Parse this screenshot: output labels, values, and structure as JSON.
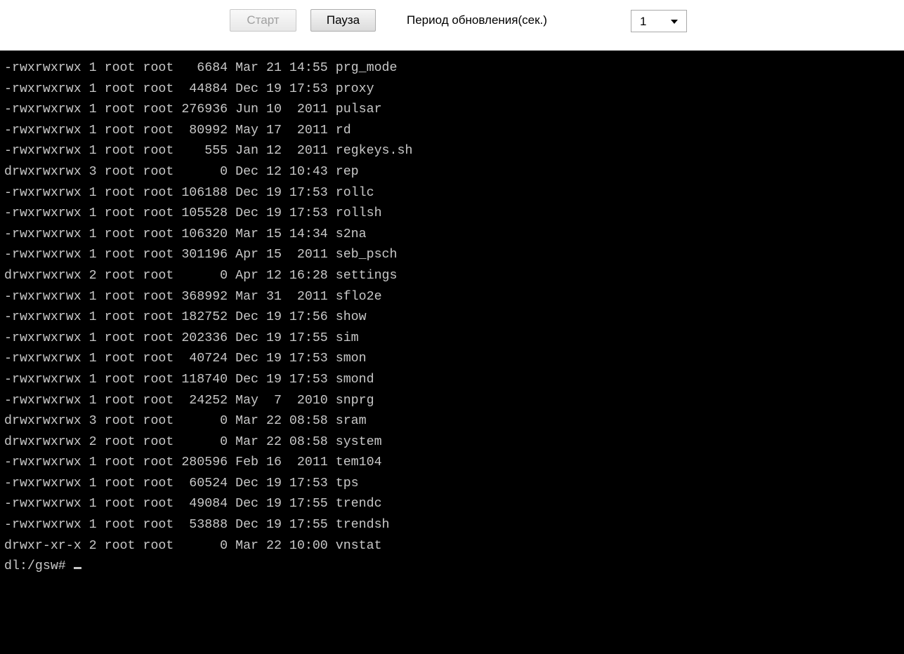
{
  "toolbar": {
    "start_label": "Старт",
    "pause_label": "Пауза",
    "period_label": "Период обновления(сек.)",
    "period_value": "1"
  },
  "terminal": {
    "lines": [
      "-rwxrwxrwx 1 root root   6684 Mar 21 14:55 prg_mode",
      "-rwxrwxrwx 1 root root  44884 Dec 19 17:53 proxy",
      "-rwxrwxrwx 1 root root 276936 Jun 10  2011 pulsar",
      "-rwxrwxrwx 1 root root  80992 May 17  2011 rd",
      "-rwxrwxrwx 1 root root    555 Jan 12  2011 regkeys.sh",
      "drwxrwxrwx 3 root root      0 Dec 12 10:43 rep",
      "-rwxrwxrwx 1 root root 106188 Dec 19 17:53 rollc",
      "-rwxrwxrwx 1 root root 105528 Dec 19 17:53 rollsh",
      "-rwxrwxrwx 1 root root 106320 Mar 15 14:34 s2na",
      "-rwxrwxrwx 1 root root 301196 Apr 15  2011 seb_psch",
      "drwxrwxrwx 2 root root      0 Apr 12 16:28 settings",
      "-rwxrwxrwx 1 root root 368992 Mar 31  2011 sflo2e",
      "-rwxrwxrwx 1 root root 182752 Dec 19 17:56 show",
      "-rwxrwxrwx 1 root root 202336 Dec 19 17:55 sim",
      "-rwxrwxrwx 1 root root  40724 Dec 19 17:53 smon",
      "-rwxrwxrwx 1 root root 118740 Dec 19 17:53 smond",
      "-rwxrwxrwx 1 root root  24252 May  7  2010 snprg",
      "drwxrwxrwx 3 root root      0 Mar 22 08:58 sram",
      "drwxrwxrwx 2 root root      0 Mar 22 08:58 system",
      "-rwxrwxrwx 1 root root 280596 Feb 16  2011 tem104",
      "-rwxrwxrwx 1 root root  60524 Dec 19 17:53 tps",
      "-rwxrwxrwx 1 root root  49084 Dec 19 17:55 trendc",
      "-rwxrwxrwx 1 root root  53888 Dec 19 17:55 trendsh",
      "drwxr-xr-x 2 root root      0 Mar 22 10:00 vnstat"
    ],
    "prompt": "dl:/gsw# "
  }
}
